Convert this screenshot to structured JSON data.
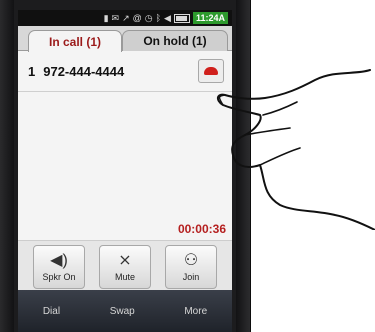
{
  "status_bar": {
    "icons": [
      "signal-icon",
      "message-icon",
      "missed-call-icon",
      "email-icon",
      "alarm-icon",
      "bluetooth-icon",
      "volume-icon",
      "battery-icon"
    ],
    "time": "11:24A"
  },
  "tabs": {
    "in_call": "In call (1)",
    "on_hold": "On hold (1)"
  },
  "call": {
    "index": "1",
    "number": "972-444-4444",
    "timer": "00:00:36"
  },
  "actions": [
    {
      "label": "Spkr On",
      "icon": "speaker-icon"
    },
    {
      "label": "Mute",
      "icon": "mute-icon"
    },
    {
      "label": "Join",
      "icon": "join-icon"
    }
  ],
  "softkeys": {
    "dial": "Dial",
    "swap": "Swap",
    "more": "More"
  },
  "colors": {
    "active_tab_text": "#9b1a1a",
    "timer": "#b52020",
    "end_call": "#d0201c",
    "clock_bg": "#2d9a2d"
  }
}
